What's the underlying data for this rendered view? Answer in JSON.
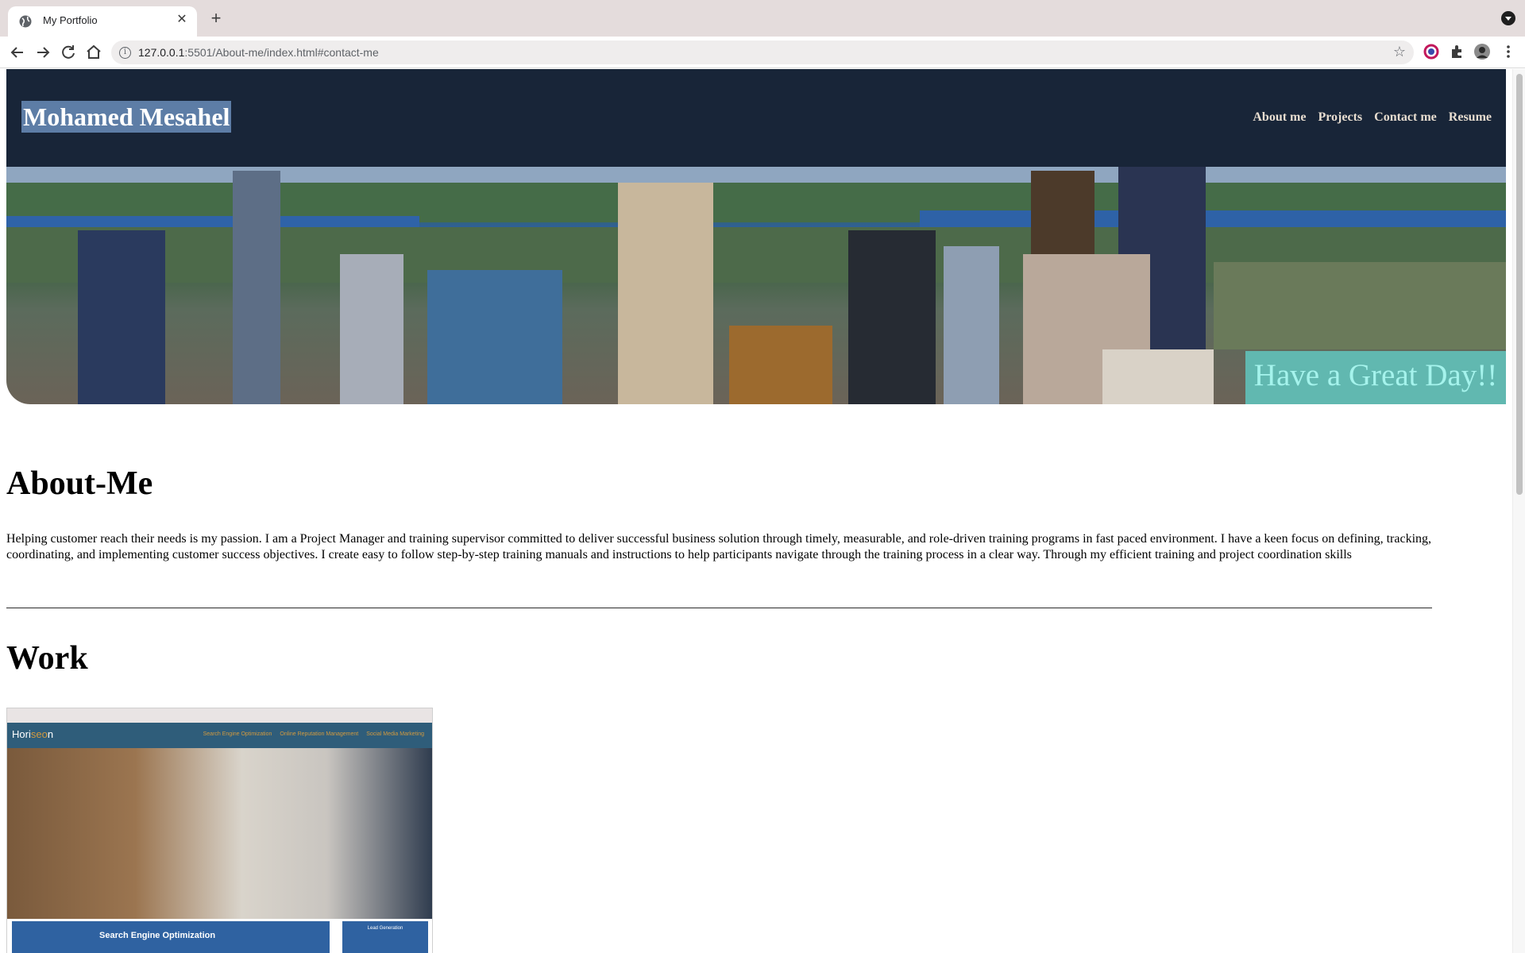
{
  "browser": {
    "tab_title": "My Portfolio",
    "url_host": "127.0.0.1",
    "url_rest": ":5501/About-me/index.html#contact-me"
  },
  "header": {
    "site_title": "Mohamed Mesahel",
    "nav": [
      "About me",
      "Projects",
      "Contact me",
      "Resume"
    ]
  },
  "hero": {
    "banner_text": "Have a Great Day!!"
  },
  "about": {
    "heading": "About-Me",
    "text": "Helping customer reach their needs is my passion. I am a Project Manager and training supervisor committed to deliver successful business solution through timely, measurable, and role-driven training programs in fast paced environment. I have a keen focus on defining, tracking, coordinating, and implementing customer success objectives. I create easy to follow step-by-step training manuals and instructions to help participants navigate through the training process in a clear way. Through my efficient training and project coordination skills"
  },
  "work": {
    "heading": "Work",
    "thumb": {
      "logo_a": "Hori",
      "logo_b": "seo",
      "logo_c": "n",
      "nav": [
        "Search Engine Optimization",
        "Online Reputation Management",
        "Social Media Marketing"
      ],
      "card_title": "Search Engine Optimization",
      "side_title": "Lead Generation"
    }
  },
  "colors": {
    "header_bg": "#182538",
    "nav_text": "#e7ddd0",
    "title_highlight": "#5d7da6",
    "banner_bg": "#61b8b0",
    "banner_text": "#a5f3ec"
  }
}
